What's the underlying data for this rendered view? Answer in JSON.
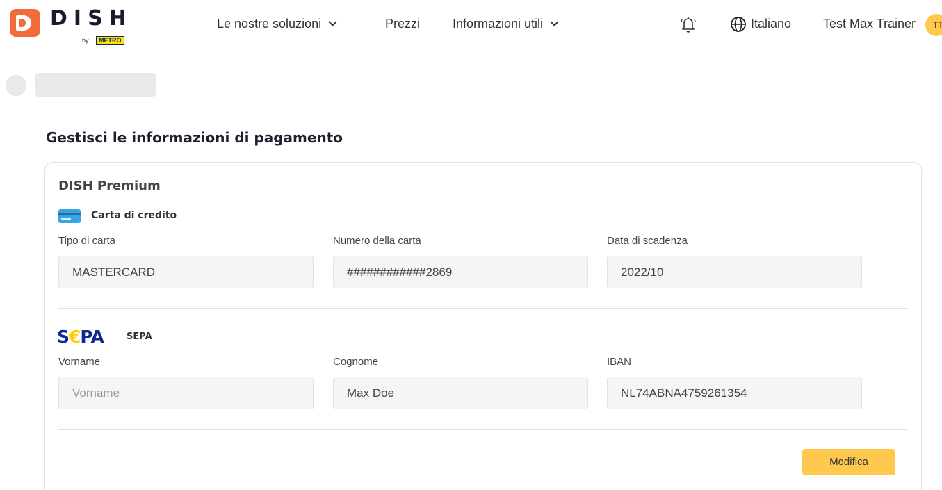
{
  "header": {
    "logo_text": "DISH",
    "logo_by": "by",
    "logo_metro": "METRO",
    "nav": [
      {
        "label": "Le nostre soluzioni",
        "has_dropdown": true
      },
      {
        "label": "Prezzi",
        "has_dropdown": false
      },
      {
        "label": "Informazioni utili",
        "has_dropdown": true
      }
    ],
    "notification_icon": "bell-icon",
    "language_icon": "globe-icon",
    "language": "Italiano",
    "user_name": "Test Max Trainer",
    "avatar_initials": "TT"
  },
  "page": {
    "title": "Gestisci le informazioni di pagamento"
  },
  "card": {
    "title": "DISH Premium",
    "credit_card": {
      "section_title": "Carta di credito",
      "icon": "credit-card-icon",
      "fields": [
        {
          "label": "Tipo di carta",
          "value": "MASTERCARD"
        },
        {
          "label": "Numero della carta",
          "value": "############2869"
        },
        {
          "label": "Data di scadenza",
          "value": "2022/10"
        }
      ]
    },
    "sepa": {
      "logo_text_1": "S",
      "logo_euro": "€",
      "logo_text_2": "PA",
      "section_title": "SEPA",
      "fields": [
        {
          "label": "Vorname",
          "value": "",
          "placeholder": "Vorname"
        },
        {
          "label": "Cognome",
          "value": "Max Doe"
        },
        {
          "label": "IBAN",
          "value": "NL74ABNA4759261354"
        }
      ]
    },
    "edit_button": "Modifica"
  },
  "colors": {
    "brand_orange": "#f26b3a",
    "button_yellow": "#ffc94f",
    "sepa_blue": "#10298e"
  }
}
